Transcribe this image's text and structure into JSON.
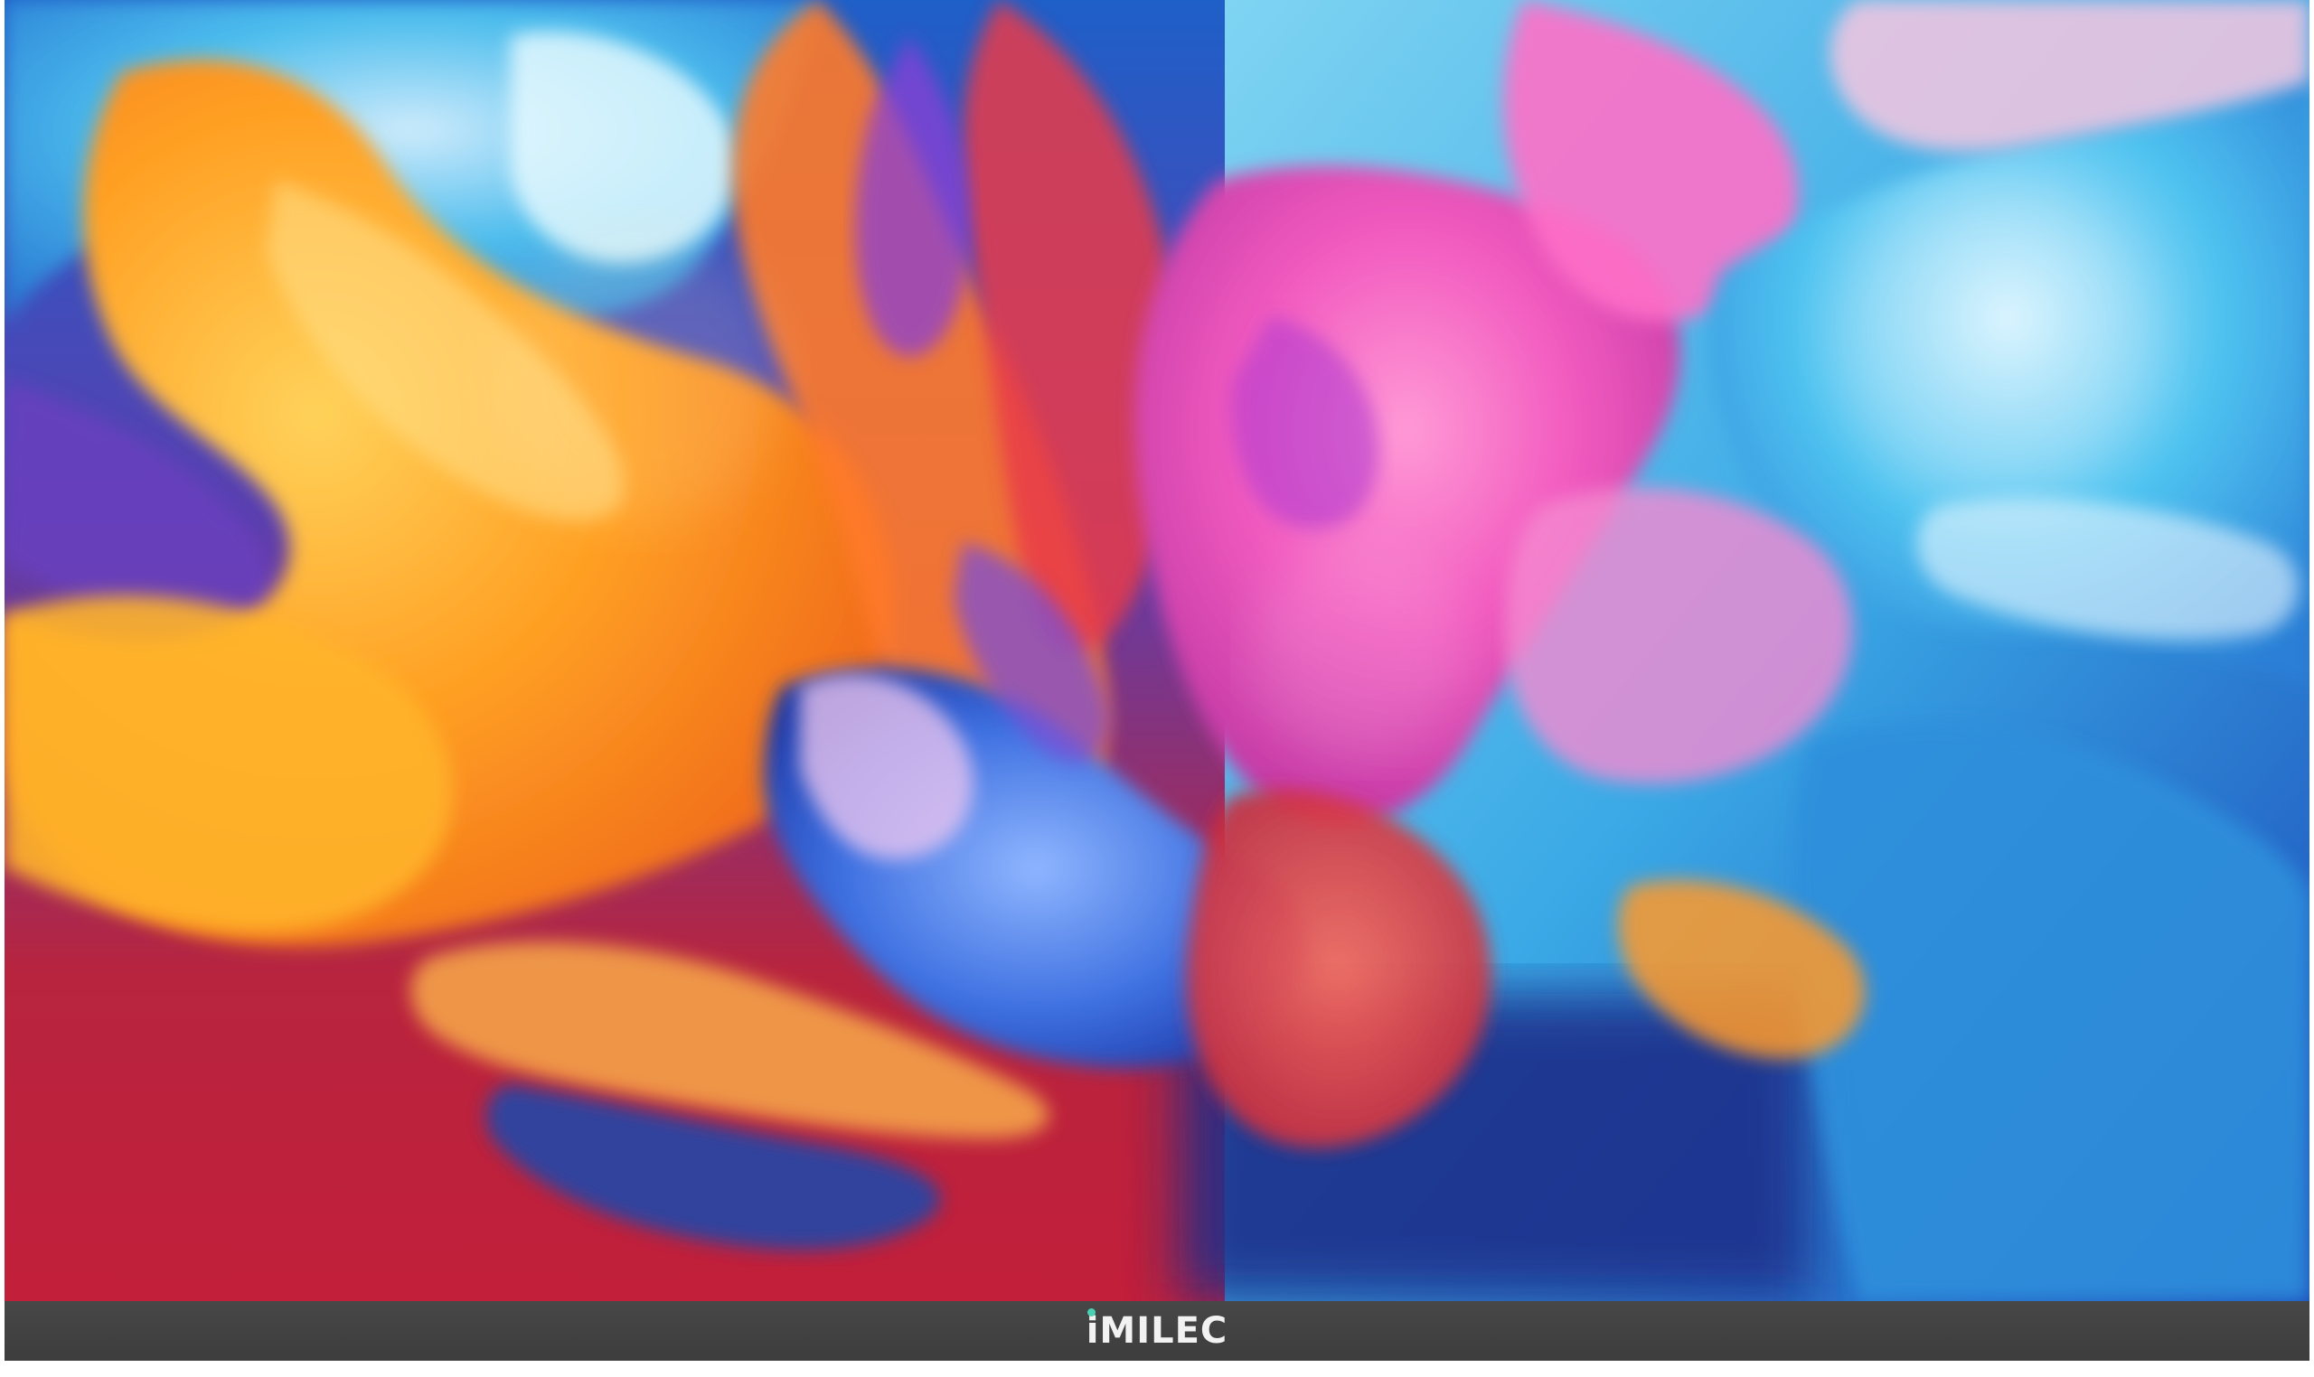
{
  "device": {
    "brand_logo": "iMILEC",
    "bezel_color": "#444444",
    "logo_color": "#f2f2f2",
    "logo_accent": "#4ad1b4"
  },
  "wallpaper": {
    "subject": "abstract-colorful-fluid-ink",
    "colors": {
      "orange": "#ff9a1f",
      "yellow": "#ffc23a",
      "pink": "#ff5fb0",
      "magenta": "#e83fc9",
      "red": "#d8283c",
      "cyan": "#35b8ec",
      "blue": "#2a5fd8",
      "violet": "#7b4fd6",
      "navy": "#1a2f8a"
    }
  }
}
